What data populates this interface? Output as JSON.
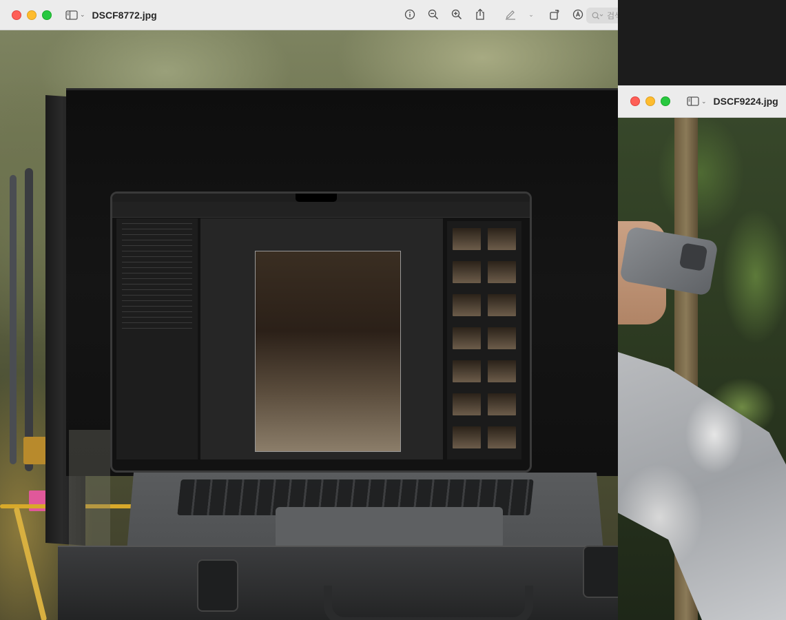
{
  "front_window": {
    "title": "DSCF8772.jpg",
    "toolbar": {
      "icons": [
        "info-icon",
        "zoom-out-icon",
        "zoom-in-icon",
        "share-icon",
        "markup-pen-icon",
        "chevron-down-icon",
        "rotate-icon",
        "annotate-icon"
      ],
      "search_placeholder": "검색"
    }
  },
  "back_window": {
    "title": "DSCF9224.jpg"
  },
  "colors": {
    "close": "#fe5f57",
    "minimize": "#febc2e",
    "zoom": "#28c840",
    "titlebar": "#ececec"
  }
}
